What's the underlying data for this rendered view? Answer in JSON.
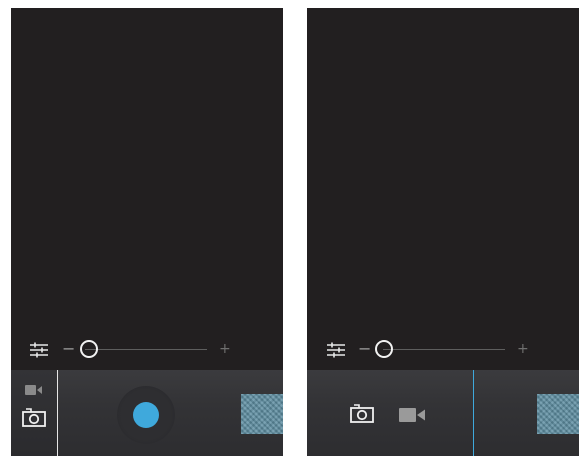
{
  "screens": [
    {
      "id": "left",
      "mode": "photo",
      "zoom": {
        "minus_label": "−",
        "plus_label": "+",
        "level": 0.0
      },
      "icons": [
        "settings-sliders-icon",
        "video-camera-icon",
        "camera-icon"
      ],
      "accent_color": "#3fa9dc"
    },
    {
      "id": "right",
      "mode": "mode-switcher",
      "zoom": {
        "minus_label": "−",
        "plus_label": "+",
        "level": 0.0
      },
      "icons": [
        "settings-sliders-icon",
        "camera-icon",
        "video-camera-icon"
      ],
      "accent_color": "#3fa9dc"
    }
  ]
}
